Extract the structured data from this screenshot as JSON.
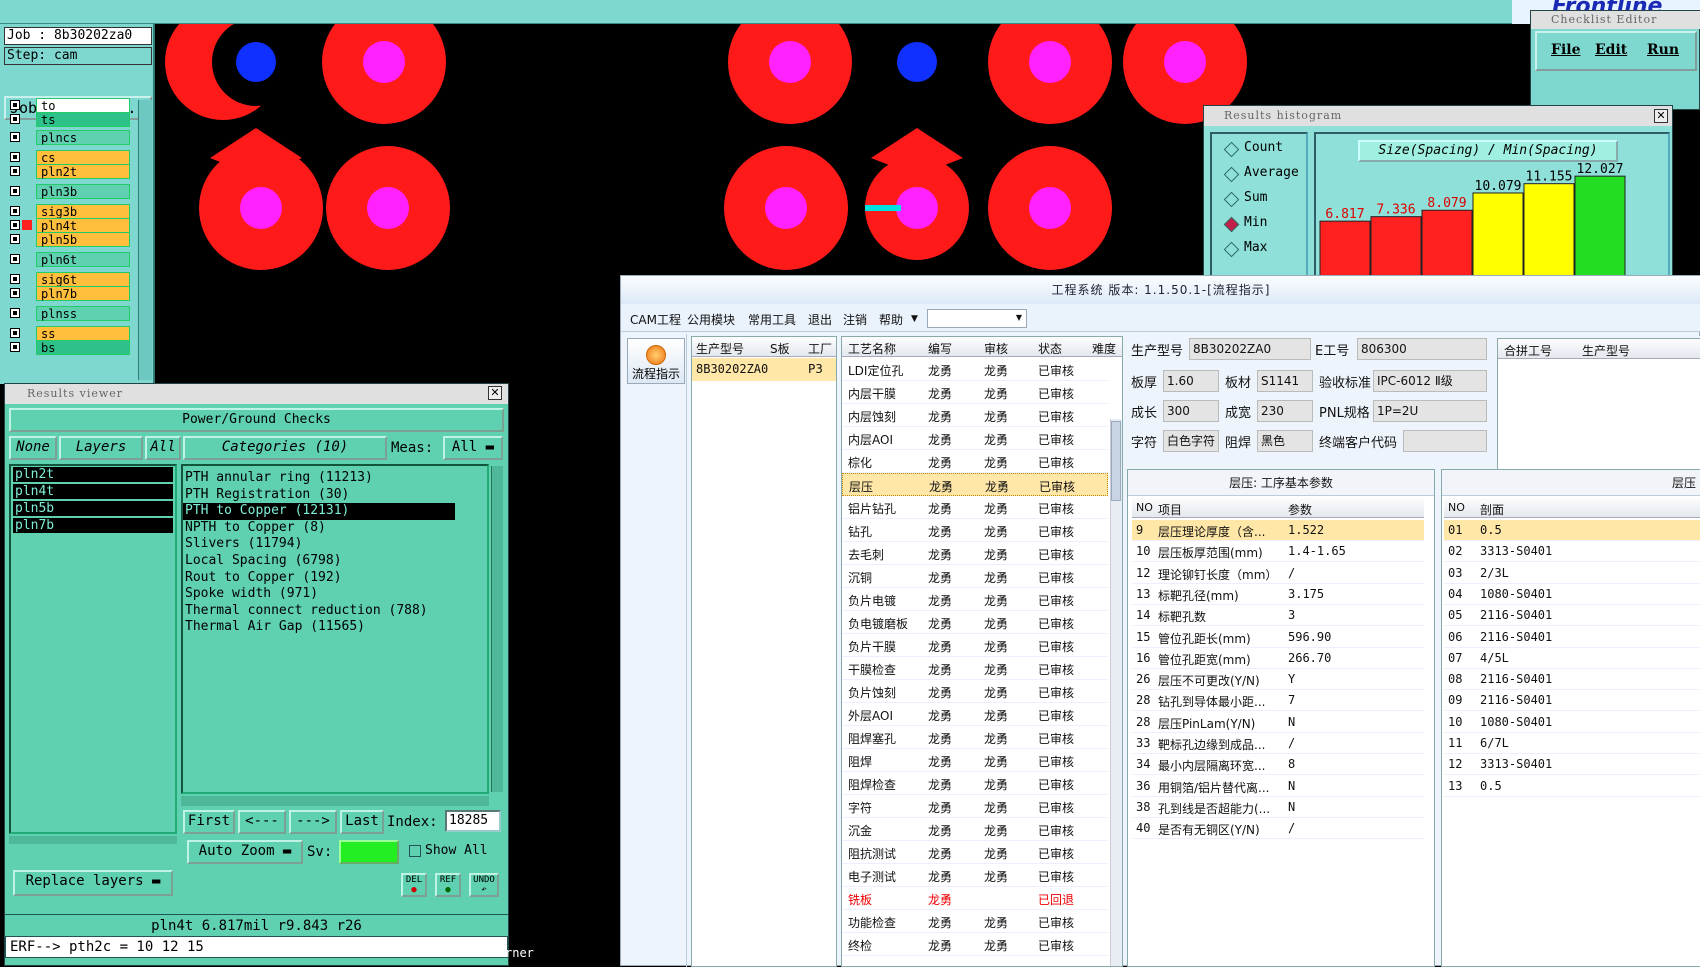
{
  "job_panel": {
    "job": "Job : 8b30202za0",
    "step": "Step: cam",
    "job_matrix": "Job Matrix ...",
    "layers": [
      {
        "name": "to",
        "color": "#ffffff"
      },
      {
        "name": "ts",
        "color": "#2ec28a"
      },
      {
        "name": "plncs",
        "color": "#5fd0b0"
      },
      {
        "name": "cs",
        "color": "#ffbe3c"
      },
      {
        "name": "pln2t",
        "color": "#ffbe3c"
      },
      {
        "name": "pln3b",
        "color": "#5fd0b0"
      },
      {
        "name": "sig3b",
        "color": "#ffbe3c"
      },
      {
        "name": "pln4t",
        "color": "#ffbe3c"
      },
      {
        "name": "pln5b",
        "color": "#ffbe3c"
      },
      {
        "name": "pln6t",
        "color": "#5fd0b0"
      },
      {
        "name": "sig6t",
        "color": "#ffbe3c"
      },
      {
        "name": "pln7b",
        "color": "#ffbe3c"
      },
      {
        "name": "plnss",
        "color": "#5fd0b0"
      },
      {
        "name": "ss",
        "color": "#ffbe3c"
      },
      {
        "name": "bs",
        "color": "#2ec28a"
      }
    ]
  },
  "results_viewer": {
    "window_title": "Results viewer",
    "header": "Power/Ground Checks",
    "none_label": "None",
    "layers_label": "Layers",
    "all_label": "All",
    "categories_label": "Categories (10)",
    "meas_label": "Meas:",
    "meas_value": "All",
    "layer_list": [
      "pln2t",
      "pln4t",
      "pln5b",
      "pln7b"
    ],
    "categories": [
      "PTH annular ring (11213)",
      "PTH Registration (30)",
      "PTH to Copper (12131)",
      "NPTH to Copper (8)",
      "Slivers (11794)",
      "Local Spacing (6798)",
      "Rout to Copper (192)",
      "Spoke width (971)",
      "Thermal connect reduction (788)",
      "Thermal Air Gap (11565)"
    ],
    "selected_category": "PTH to Copper (12131)",
    "first": "First",
    "prev": "<---",
    "next": "--->",
    "last": "Last",
    "index_label": "Index:",
    "index_value": "18285",
    "auto_zoom": "Auto Zoom",
    "sv_label": "Sv:",
    "show_all": "Show All",
    "replace_layers": "Replace layers",
    "del": "DEL",
    "ref": "REF",
    "undo": "UNDO",
    "status_line": "pln4t 6.817mil   r9.843   r26",
    "erf_line": "ERF--> pth2c = 10 12 15",
    "corner_text": "rner"
  },
  "histogram": {
    "window_title": "Results histogram",
    "options": [
      "Count",
      "Average",
      "Sum",
      "Min",
      "Max"
    ],
    "selected": "Min",
    "chart_title": "Size(Spacing) / Min(Spacing)",
    "bars": [
      {
        "value": "6.817",
        "color": "#ff2020"
      },
      {
        "value": "7.336",
        "color": "#ff2020"
      },
      {
        "value": "8.079",
        "color": "#ff2020"
      },
      {
        "value": "10.079",
        "color": "#ffff00"
      },
      {
        "value": "11.155",
        "color": "#ffff00"
      },
      {
        "value": "12.027",
        "color": "#22dd22"
      }
    ]
  },
  "checklist_editor": {
    "window_title": "Checklist Editor",
    "menu": [
      "File",
      "Edit",
      "Run"
    ]
  },
  "cam_system": {
    "title": "工程系统 版本: 1.1.50.1-[流程指示]",
    "menu": [
      "CAM工程",
      "公用模块",
      "常用工具",
      "退出",
      "注销",
      "帮助"
    ],
    "flow_button": "流程指示",
    "order_headers": [
      "生产型号",
      "S板",
      "工厂"
    ],
    "order_row": {
      "model": "8B30202ZA0",
      "s": "",
      "factory": "P3"
    },
    "process_headers": [
      "工艺名称",
      "编写",
      "审核",
      "状态",
      "难度"
    ],
    "processes": [
      [
        "LDI定位孔",
        "龙勇",
        "龙勇",
        "已审核"
      ],
      [
        "内层干膜",
        "龙勇",
        "龙勇",
        "已审核"
      ],
      [
        "内层蚀刻",
        "龙勇",
        "龙勇",
        "已审核"
      ],
      [
        "内层AOI",
        "龙勇",
        "龙勇",
        "已审核"
      ],
      [
        "棕化",
        "龙勇",
        "龙勇",
        "已审核"
      ],
      [
        "层压",
        "龙勇",
        "龙勇",
        "已审核"
      ],
      [
        "铝片钻孔",
        "龙勇",
        "龙勇",
        "已审核"
      ],
      [
        "钻孔",
        "龙勇",
        "龙勇",
        "已审核"
      ],
      [
        "去毛刺",
        "龙勇",
        "龙勇",
        "已审核"
      ],
      [
        "沉铜",
        "龙勇",
        "龙勇",
        "已审核"
      ],
      [
        "负片电镀",
        "龙勇",
        "龙勇",
        "已审核"
      ],
      [
        "负电镀磨板",
        "龙勇",
        "龙勇",
        "已审核"
      ],
      [
        "负片干膜",
        "龙勇",
        "龙勇",
        "已审核"
      ],
      [
        "干膜检查",
        "龙勇",
        "龙勇",
        "已审核"
      ],
      [
        "负片蚀刻",
        "龙勇",
        "龙勇",
        "已审核"
      ],
      [
        "外层AOI",
        "龙勇",
        "龙勇",
        "已审核"
      ],
      [
        "阻焊塞孔",
        "龙勇",
        "龙勇",
        "已审核"
      ],
      [
        "阻焊",
        "龙勇",
        "龙勇",
        "已审核"
      ],
      [
        "阻焊检查",
        "龙勇",
        "龙勇",
        "已审核"
      ],
      [
        "字符",
        "龙勇",
        "龙勇",
        "已审核"
      ],
      [
        "沉金",
        "龙勇",
        "龙勇",
        "已审核"
      ],
      [
        "阻抗测试",
        "龙勇",
        "龙勇",
        "已审核"
      ],
      [
        "电子测试",
        "龙勇",
        "龙勇",
        "已审核"
      ],
      [
        "铣板",
        "龙勇",
        "",
        "已回退"
      ],
      [
        "功能检查",
        "龙勇",
        "龙勇",
        "已审核"
      ],
      [
        "终检",
        "龙勇",
        "龙勇",
        "已审核"
      ]
    ],
    "selected_process": "层压",
    "rejected_process": "铣板",
    "info": {
      "model_label": "生产型号",
      "model": "8B30202ZA0",
      "eno_label": "E工号",
      "eno": "806300",
      "thick_label": "板厚",
      "thick": "1.60",
      "material_label": "板材",
      "material": "S1141",
      "std_label": "验收标准",
      "std": "IPC-6012 Ⅱ级",
      "len_label": "成长",
      "len": "300",
      "width_label": "成宽",
      "width": "230",
      "pnl_label": "PNL规格",
      "pnl": "1P=2U",
      "char_label": "字符",
      "char": "白色字符",
      "mask_label": "阻焊",
      "mask": "黑色",
      "cust_label": "终端客户代码",
      "cust": ""
    },
    "merge_headers": [
      "合拼工号",
      "生产型号"
    ],
    "param_section_title": "层压: 工序基本参数",
    "param_headers": [
      "NO",
      "项目",
      "参数"
    ],
    "params": [
      [
        "9",
        "层压理论厚度（含...",
        "1.522"
      ],
      [
        "10",
        "层压板厚范围(mm)",
        "1.4-1.65"
      ],
      [
        "12",
        "理论铆钉长度（mm）",
        "/"
      ],
      [
        "13",
        "标靶孔径(mm)",
        "3.175"
      ],
      [
        "14",
        "标靶孔数",
        "3"
      ],
      [
        "15",
        "管位孔距长(mm)",
        "596.90"
      ],
      [
        "16",
        "管位孔距宽(mm)",
        "266.70"
      ],
      [
        "26",
        "层压不可更改(Y/N)",
        "Y"
      ],
      [
        "28",
        "钻孔到导体最小距...",
        "7"
      ],
      [
        "28",
        "层压PinLam(Y/N)",
        "N"
      ],
      [
        "33",
        "靶标孔边缘到成品...",
        "/"
      ],
      [
        "34",
        "最小内层隔离环宽...",
        "8"
      ],
      [
        "36",
        "用铜箔/铝片替代离...",
        "N"
      ],
      [
        "38",
        "孔到线是否超能力(...",
        "N"
      ],
      [
        "40",
        "是否有无铜区(Y/N)",
        "/"
      ]
    ],
    "side_section_title": "层压",
    "side_headers": [
      "NO",
      "剖面"
    ],
    "side_rows": [
      [
        "01",
        "0.5"
      ],
      [
        "02",
        "3313-S0401"
      ],
      [
        "03",
        "2/3L"
      ],
      [
        "04",
        "1080-S0401"
      ],
      [
        "05",
        "2116-S0401"
      ],
      [
        "06",
        "2116-S0401"
      ],
      [
        "07",
        "4/5L"
      ],
      [
        "08",
        "2116-S0401"
      ],
      [
        "09",
        "2116-S0401"
      ],
      [
        "10",
        "1080-S0401"
      ],
      [
        "11",
        "6/7L"
      ],
      [
        "12",
        "3313-S0401"
      ],
      [
        "13",
        "0.5"
      ]
    ]
  }
}
